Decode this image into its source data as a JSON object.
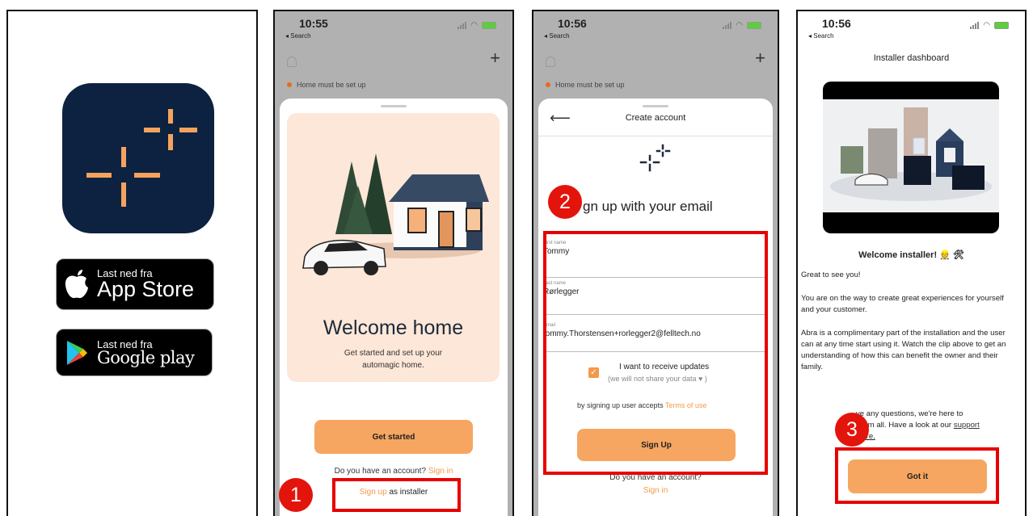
{
  "panel1": {
    "appstore": {
      "small": "Last ned fra",
      "big": "App Store"
    },
    "googleplay": {
      "small": "Last ned fra",
      "big": "Google play"
    }
  },
  "panel2": {
    "time": "10:55",
    "back": "◂ Search",
    "plus": "+",
    "home_status": "Home must be set up",
    "welcome_title": "Welcome home",
    "welcome_sub": "Get started and set up your automagic home.",
    "get_started": "Get started",
    "have_account": "Do you have an account?",
    "sign_in": "Sign in",
    "sign_up": "Sign up",
    "as_installer": "as installer",
    "step": "1"
  },
  "panel3": {
    "time": "10:56",
    "back": "◂ Search",
    "plus": "+",
    "home_status": "Home must be set up",
    "nav_back": "⟵",
    "nav_title": "Create account",
    "signup_title": "gn up with your email",
    "step": "2",
    "fields": [
      {
        "label": "First name",
        "value": "Tommy"
      },
      {
        "label": "Last name",
        "value": "Rørlegger"
      },
      {
        "label": "Email",
        "value": "tommy.Thorstensen+rorlegger2@felltech.no"
      }
    ],
    "check_mark": "✓",
    "updates_line1": "I want to receive updates",
    "updates_line2": "(we will not share your data ♥ )",
    "terms_prefix": "by signing up user accepts",
    "terms_link": "Terms of use",
    "sign_up_button": "Sign Up",
    "have_account": "Do you have an account?",
    "sign_in": "Sign in"
  },
  "panel4": {
    "time": "10:56",
    "back": "◂ Search",
    "title": "Installer dashboard",
    "welcome": "Welcome installer! 👷 🛠",
    "greeting": "Great to see you!",
    "para1": "You are on the way to create great experiences for yourself and your customer.",
    "para2": "Abra is a complimentary part of the installation and the user can at any time start using it. Watch the clip above to get an understanding of how this can benefit the owner and their family.",
    "para3_part1": "ve any questions, we're here to",
    "para3_part2": "hem all. Have a look at our",
    "para3_link1": "support",
    "para3_link2": "here.",
    "got_it": "Got it",
    "step": "3"
  },
  "colors": {
    "accent_orange": "#f6a661",
    "link_orange": "#f29a4a",
    "annotation_red": "#e80000",
    "app_icon_bg": "#0d2240"
  }
}
